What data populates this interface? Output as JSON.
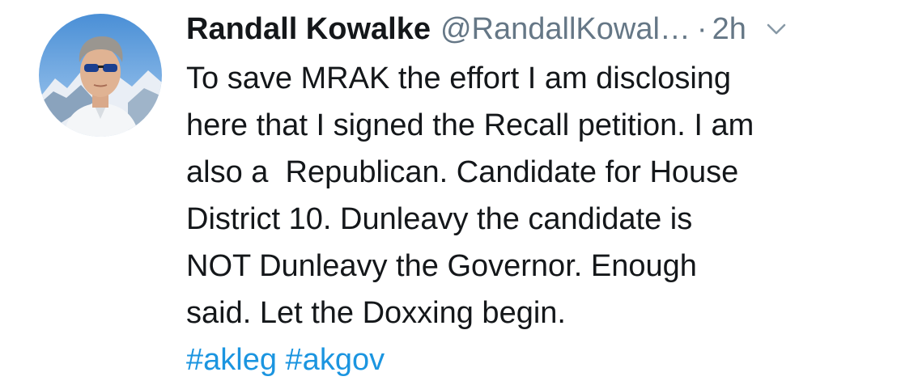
{
  "tweet": {
    "author": {
      "display_name": "Randall Kowalke",
      "handle": "@RandallKowal…",
      "avatar_icon": "profile-photo"
    },
    "separator": "·",
    "timestamp": "2h",
    "menu_icon": "chevron-down-icon",
    "text_lines": [
      "To save MRAK the effort I am disclosing",
      "here that I signed the Recall petition. I am",
      "also a  Republican. Candidate for House",
      "District 10. Dunleavy the candidate is",
      "NOT Dunleavy the Governor. Enough",
      "said. Let the Doxxing begin."
    ],
    "hashtags": [
      "#akleg",
      "#akgov"
    ]
  },
  "colors": {
    "text": "#14171a",
    "secondary": "#657786",
    "link": "#1b95e0"
  }
}
